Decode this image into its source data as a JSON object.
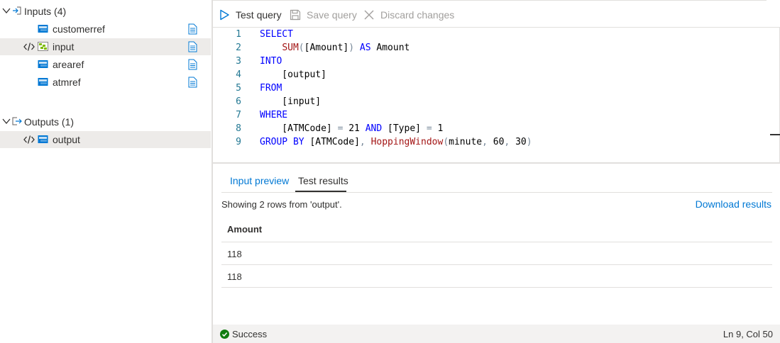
{
  "tree": {
    "inputs_label": "Inputs (4)",
    "outputs_label": "Outputs (1)",
    "inputs": [
      {
        "label": "customerref"
      },
      {
        "label": "input"
      },
      {
        "label": "arearef"
      },
      {
        "label": "atmref"
      }
    ],
    "outputs": [
      {
        "label": "output"
      }
    ]
  },
  "toolbar": {
    "test_label": "Test query",
    "save_label": "Save query",
    "discard_label": "Discard changes"
  },
  "editor": {
    "line_numbers": [
      "1",
      "2",
      "3",
      "4",
      "5",
      "6",
      "7",
      "8",
      "9"
    ],
    "cursor": "Ln 9, Col 50"
  },
  "results": {
    "tabs": [
      "Input preview",
      "Test results"
    ],
    "active_tab": "Test results",
    "summary": "Showing 2 rows from 'output'.",
    "download_label": "Download results",
    "column": "Amount",
    "rows": [
      "118",
      "118"
    ]
  },
  "status": {
    "text": "Success"
  },
  "colors": {
    "accent": "#0078d4",
    "keyword": "#0000ff",
    "success": "#107c10",
    "selected_row": "#edebe9"
  }
}
